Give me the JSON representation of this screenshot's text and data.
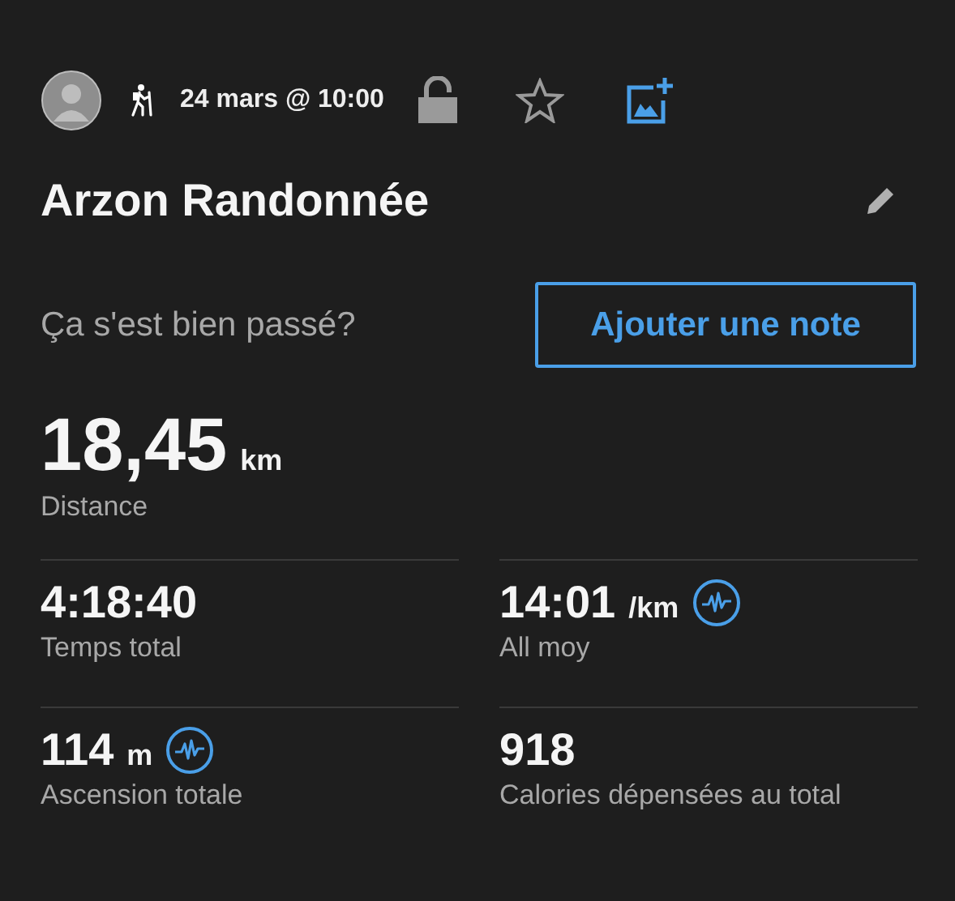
{
  "header": {
    "date": "24 mars @ 10:00",
    "locked": false,
    "starred": false
  },
  "title": "Arzon Randonnée",
  "feedback": {
    "question": "Ça s'est bien passé?",
    "button": "Ajouter une note"
  },
  "main_stat": {
    "value": "18,45",
    "unit": "km",
    "label": "Distance"
  },
  "stats": [
    {
      "value": "4:18:40",
      "label": "Temps total",
      "chart": false
    },
    {
      "value": "14:01",
      "unit": "/km",
      "label": "All moy",
      "chart": true
    },
    {
      "value": "114",
      "unit": "m",
      "label": "Ascension totale",
      "chart": true
    },
    {
      "value": "918",
      "label": "Calories dépensées au total",
      "chart": false
    }
  ]
}
